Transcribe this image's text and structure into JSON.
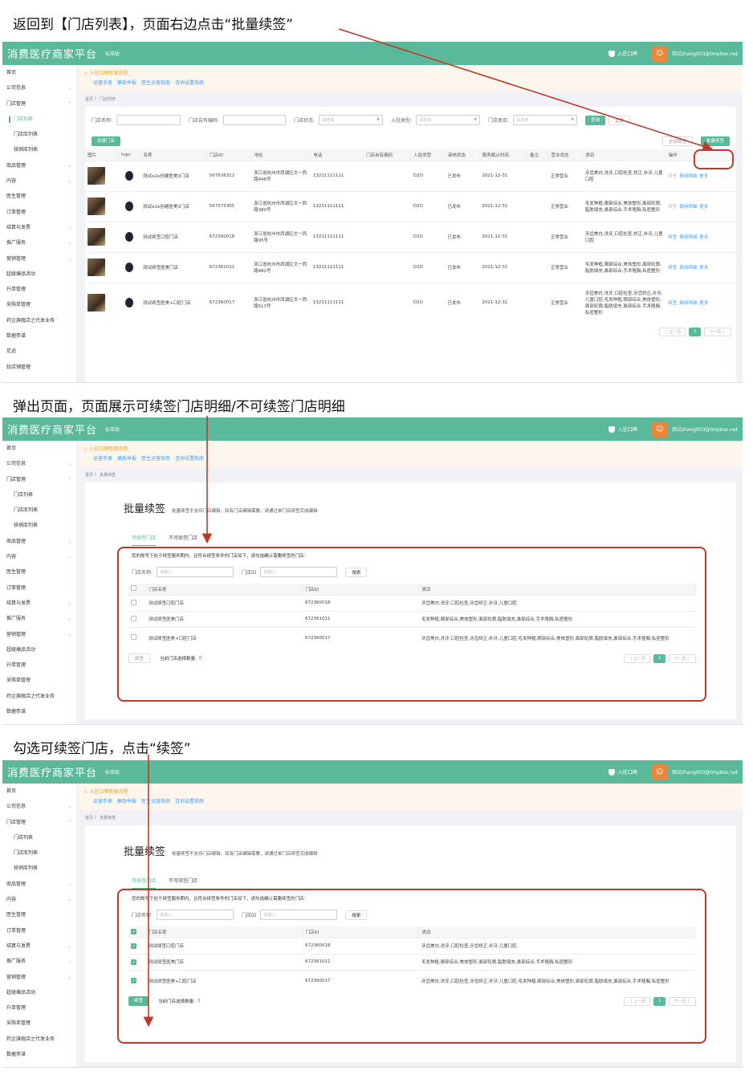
{
  "steps": [
    "返回到【门店列表】，页面右边点击“批量续签”",
    "弹出页面，页面展示可续签门店明细/不可续签门店明细",
    "勾选可续签门店，点击“续签”"
  ],
  "app": {
    "brand": "消费医疗商家平台",
    "edition_1": "标准版",
    "edition_2": "标准版",
    "entry": "入驻口碑",
    "user": "测试zhang003@tmpbox.net"
  },
  "notice": {
    "title": "入驻口碑新版流程",
    "links": [
      "运营手册",
      "廉政举报",
      "医生运营指南",
      "咨询设置指南"
    ]
  },
  "sidebar1": [
    "首页",
    "公司信息",
    "门店管理",
    "门店列表",
    "门店库列表",
    "核销库列表",
    "商品管理",
    "内容",
    "医生管理",
    "订单管理",
    "结算与发票",
    "推广服务",
    "营销管理",
    "超级爆品活动",
    "升单管理",
    "采购单管理",
    "药企旗舰店之代发业务",
    "数据参谋",
    "足迹",
    "轻店铺管理"
  ],
  "sidebar2": [
    "首页",
    "公司信息",
    "门店管理",
    "门店列表",
    "门店库列表",
    "核销库列表",
    "商品管理",
    "内容",
    "医生管理",
    "订单管理",
    "结算与发票",
    "推广服务",
    "营销管理",
    "超级爆品活动",
    "升单管理",
    "采购单管理",
    "药企旗舰店之代发业务",
    "数据参谋"
  ],
  "bc1": "首页 〉 门店列表",
  "bc2": "首页 〉 批量续签",
  "filters": {
    "store_name": "门店名称:",
    "store_code": "门店自有编码:",
    "store_status": "门店状态:",
    "entry_type": "入驻类型:",
    "store_category": "门店类目:",
    "placeholder": "请选择",
    "query": "查询",
    "reset": "重置"
  },
  "buttons": {
    "create": "创建门店",
    "all_renew": "全部续签",
    "batch_renew": "批量续签"
  },
  "list_headers": [
    "图片",
    "logo",
    "名称",
    "门店ID",
    "地址",
    "电话",
    "门店自有编码",
    "入驻类型",
    "审核状态",
    "服务截止时间",
    "备注",
    "营业状态",
    "类目",
    "操作"
  ],
  "list_rows": [
    {
      "name": "测试e2e创建医美3门店",
      "id": "567636312",
      "addr": "浙江省杭州市西湖区文一西路448号",
      "phone": "13211111111",
      "type": "O2O",
      "audit": "已发布",
      "deadline": "2021-12-31",
      "biz": "正常营业",
      "cat": "牙齿美白,洗牙,口腔检查,矫正,补牙,儿童口腔",
      "ops": [
        "续签",
        "费用明细",
        "更多"
      ]
    },
    {
      "name": "测试e2e创建医美3门店",
      "id": "567575305",
      "addr": "浙江省杭州市西湖区文一西路380号",
      "phone": "13211111111",
      "type": "O2O",
      "audit": "已发布",
      "deadline": "2021-12-31",
      "biz": "正常营业",
      "cat": "毛发种植,眼部综合,美体塑形,面部轮廓,脂肪填充,鼻部综合,手术隆胸,私密整形",
      "ops": [
        "续签",
        "费用明细",
        "更多"
      ]
    },
    {
      "name": "测试续签口腔门店",
      "id": "672360018",
      "addr": "浙江省杭州市西湖区文一西路95号",
      "phone": "13211111111",
      "type": "O2O",
      "audit": "已发布",
      "deadline": "2021-12-31",
      "biz": "正常营业",
      "cat": "牙齿美白,洗牙,口腔检查,矫正,补牙,儿童口腔",
      "ops": [
        "续签",
        "费用明细",
        "更多"
      ]
    },
    {
      "name": "测试续签医美门店",
      "id": "672361011",
      "addr": "浙江省杭州市西湖区文一西路482号",
      "phone": "13211111111",
      "type": "O2O",
      "audit": "已发布",
      "deadline": "2021-12-31",
      "biz": "正常营业",
      "cat": "毛发种植,眼部综合,美体塑形,面部轮廓,脂肪填充,鼻部综合,手术隆胸,私密整形",
      "ops": [
        "续签",
        "费用明细",
        "更多"
      ]
    },
    {
      "name": "测试续签医美+口腔门店",
      "id": "672360017",
      "addr": "浙江省杭州市西湖区文一西路513号",
      "phone": "13211111111",
      "type": "O2O",
      "audit": "已发布",
      "deadline": "2021-12-31",
      "biz": "正常营业",
      "cat": "牙齿美白,洗牙,口腔检查,牙齿矫正,补牙,儿童口腔,毛发种植,眼部综合,美体塑形,面部轮廓,脂肪填充,鼻部综合,手术隆胸,私密整形",
      "ops": [
        "续签",
        "费用明细",
        "更多"
      ]
    }
  ],
  "pager": {
    "prev": "〈 上一页",
    "page": "1",
    "next": "下一页 〉"
  },
  "renew": {
    "title": "批量续签",
    "desc": "批量续签不支持门店编辑，如有门店编辑需要，请通过单门店续签完成编辑",
    "tab_ok": "可续签门店",
    "tab_no": "不可续签门店",
    "hint": "您的账号下处于续签服务期内，且符合续签条件的门店如下，请勾选确认需要续签的门店：",
    "name_label": "门店名称:",
    "id_label": "门店ID",
    "placeholder": "请输入",
    "search": "搜索",
    "headers": [
      "门店名称",
      "门店ID",
      "类目"
    ],
    "rows": [
      {
        "name": "测试续签口腔门店",
        "id": "672360018",
        "cat": "牙齿美白,洗牙,口腔检查,牙齿矫正,补牙,儿童口腔"
      },
      {
        "name": "测试续签医美门店",
        "id": "672361011",
        "cat": "毛发种植,眼部综合,美体塑形,面部轮廓,脂肪填充,鼻部综合,手术隆胸,私密整形"
      },
      {
        "name": "测试续签医美+口腔门店",
        "id": "672360017",
        "cat": "牙齿美白,洗牙,口腔检查,牙齿矫正,补牙,儿童口腔,毛发种植,眼部综合,美体塑形,面部轮廓,脂肪填充,鼻部综合,手术隆胸,私密整形"
      }
    ],
    "renew_btn": "续签",
    "count_label": "当前门店选择数量:",
    "count_before": "0",
    "count_after": "3"
  },
  "colors": {
    "brand": "#5bb99b",
    "highlight": "#c0392b",
    "link": "#409eff"
  }
}
